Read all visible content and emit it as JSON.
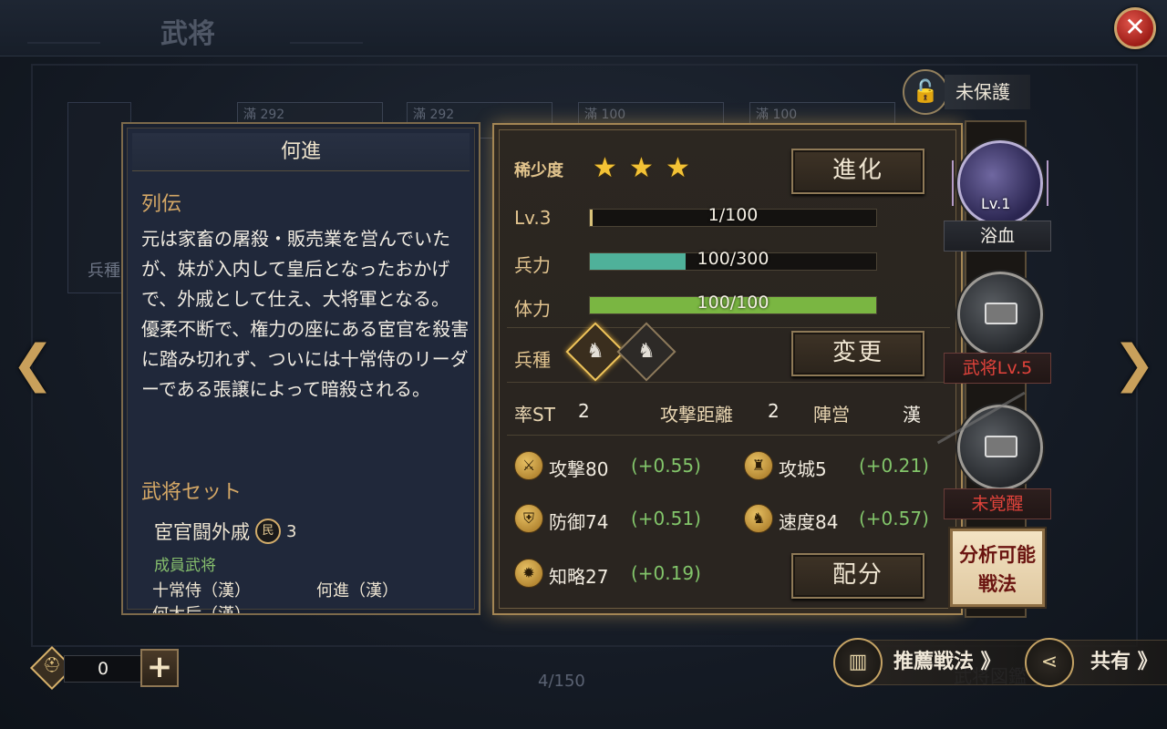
{
  "header": {
    "title": "武将",
    "close_icon": "close-icon"
  },
  "background": {
    "left_card_label": "兵種",
    "page_counter": "4/150",
    "cards": [
      "滿 292",
      "滿 292",
      "滿 100",
      "滿 100"
    ],
    "bottom_button": "武将図鑑"
  },
  "bio": {
    "name": "何進",
    "section_heading": "列伝",
    "text": "元は家畜の屠殺・販売業を営んでいたが、妹が入内して皇后となったおかげで、外戚として仕え、大将軍となる。\n優柔不断で、権力の座にある宦官を殺害に踏み切れず、ついには十常侍のリーダーである張譲によって暗殺される。",
    "set_heading": "武将セット",
    "set_name": "宦官闘外戚",
    "set_badge_text": "民",
    "set_count": "3",
    "members_heading": "成員武将",
    "members": [
      "十常侍（漢）",
      "何進（漢）",
      "何太后（漢）"
    ]
  },
  "stats": {
    "rarity_label": "稀少度",
    "stars": 3,
    "evolve_button": "進化",
    "level_label": "Lv.3",
    "exp_text": "1/100",
    "exp_fraction": 0.01,
    "troops_label": "兵力",
    "troops_text": "100/300",
    "troops_fraction": 0.3333,
    "stamina_label": "体力",
    "stamina_text": "100/100",
    "stamina_fraction": 1.0,
    "unit_label": "兵種",
    "change_button": "変更",
    "cost_label": "率ST",
    "cost_value": "2",
    "range_label": "攻撃距離",
    "range_value": "2",
    "faction_label": "陣営",
    "faction_value": "漢",
    "attributes": [
      {
        "name": "攻撃80",
        "bonus": "(+0.55)",
        "icon": "sword-icon"
      },
      {
        "name": "攻城5",
        "bonus": "(+0.21)",
        "icon": "castle-icon"
      },
      {
        "name": "防御74",
        "bonus": "(+0.51)",
        "icon": "shield-icon"
      },
      {
        "name": "速度84",
        "bonus": "(+0.57)",
        "icon": "horse-icon"
      },
      {
        "name": "知略27",
        "bonus": "(+0.19)",
        "icon": "flame-icon"
      }
    ],
    "allocate_button": "配分"
  },
  "right": {
    "lock_label": "未保護",
    "skill1_level": "Lv.1",
    "skill1_name": "浴血",
    "skill2_name": "武将Lv.5",
    "skill3_name": "未覚醒",
    "analyze_button": "分析可能\n戦法"
  },
  "bottom": {
    "currency_value": "0",
    "plus_label": "+",
    "recommend_label": "推薦戦法 》",
    "share_label": "共有 》"
  },
  "colors": {
    "accent_gold": "#d5a866",
    "troops_bar": "#4fb19a",
    "stamina_bar": "#7ab642",
    "bonus_green": "#82c56a",
    "locked_red": "#e2433b"
  }
}
